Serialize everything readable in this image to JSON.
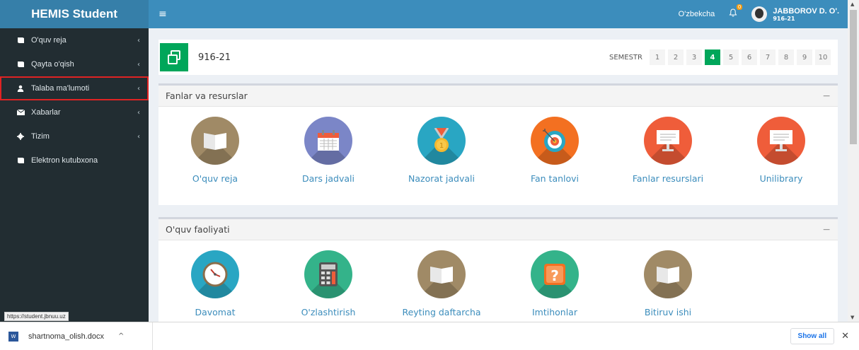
{
  "brand": "HEMIS Student",
  "sidebar": {
    "items": [
      {
        "label": "O'quv reja",
        "icon": "book-icon"
      },
      {
        "label": "Qayta o'qish",
        "icon": "book-icon"
      },
      {
        "label": "Talaba ma'lumoti",
        "icon": "user-icon",
        "highlighted": true
      },
      {
        "label": "Xabarlar",
        "icon": "envelope-icon"
      },
      {
        "label": "Tizim",
        "icon": "gear-icon"
      },
      {
        "label": "Elektron kutubxona",
        "icon": "book-icon"
      }
    ]
  },
  "status_url": "https://student.jbnuu.uz",
  "topbar": {
    "language": "O'zbekcha",
    "notification_count": "0",
    "user_name": "JABBOROV D. O'.",
    "user_group": "916-21"
  },
  "semester_bar": {
    "group": "916-21",
    "label": "SEMESTR",
    "semesters": [
      "1",
      "2",
      "3",
      "4",
      "5",
      "6",
      "7",
      "8",
      "9",
      "10"
    ],
    "active": "4"
  },
  "panels": [
    {
      "title": "Fanlar va resurslar",
      "collapse": "−",
      "tiles": [
        {
          "label": "O'quv reja",
          "icon": "open-book-icon",
          "color": "#a08a66"
        },
        {
          "label": "Dars jadvali",
          "icon": "calendar-icon",
          "color": "#7b86c7"
        },
        {
          "label": "Nazorat jadvali",
          "icon": "medal-icon",
          "color": "#29a6c3"
        },
        {
          "label": "Fan tanlovi",
          "icon": "target-icon",
          "color": "#f37021"
        },
        {
          "label": "Fanlar resurslari",
          "icon": "presentation-board-icon",
          "color": "#ef5d3a"
        },
        {
          "label": "Unilibrary",
          "icon": "presentation-board-icon",
          "color": "#ef5d3a"
        }
      ]
    },
    {
      "title": "O'quv faoliyati",
      "collapse": "−",
      "tiles": [
        {
          "label": "Davomat",
          "icon": "clock-icon",
          "color": "#29a6c3"
        },
        {
          "label": "O'zlashtirish",
          "icon": "calculator-icon",
          "color": "#34b38a"
        },
        {
          "label": "Reyting daftarcha",
          "icon": "open-book-icon",
          "color": "#a08a66"
        },
        {
          "label": "Imtihonlar",
          "icon": "question-icon",
          "color": "#34b38a"
        },
        {
          "label": "Bitiruv ishi",
          "icon": "open-book-icon",
          "color": "#a08a66"
        }
      ]
    }
  ],
  "download_bar": {
    "file_name": "shartnoma_olish.docx",
    "show_all": "Show all",
    "close": "✕"
  }
}
